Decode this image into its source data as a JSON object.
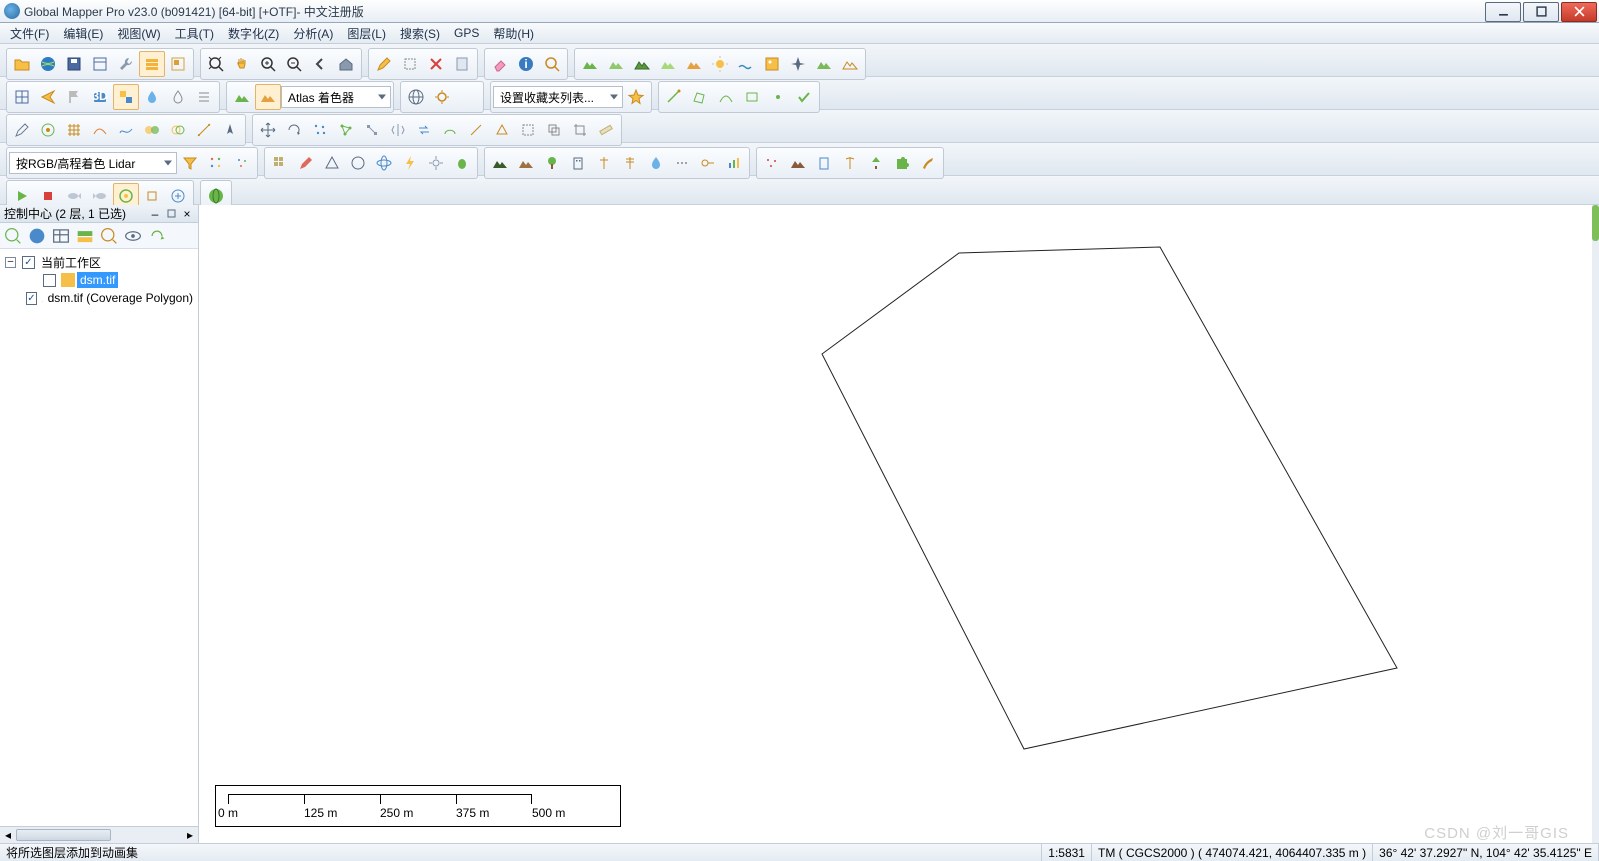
{
  "window": {
    "title": "Global Mapper Pro v23.0 (b091421) [64-bit] [+OTF]- 中文注册版"
  },
  "menu": [
    "文件(F)",
    "编辑(E)",
    "视图(W)",
    "工具(T)",
    "数字化(Z)",
    "分析(A)",
    "图层(L)",
    "搜索(S)",
    "GPS",
    "帮助(H)"
  ],
  "combos": {
    "shader": "Atlas 着色器",
    "favorites": "设置收藏夹列表...",
    "lidar": "按RGB/高程着色 Lidar"
  },
  "panel": {
    "title": "控制中心 (2 层, 1 已选)",
    "root": "当前工作区",
    "layers": [
      {
        "name": "dsm.tif",
        "checked": false,
        "selected": true
      },
      {
        "name": "dsm.tif (Coverage Polygon)",
        "checked": true,
        "selected": false
      }
    ]
  },
  "scale": {
    "labels": [
      "0 m",
      "125 m",
      "250 m",
      "375 m",
      "500 m"
    ]
  },
  "status": {
    "left": "将所选图层添加到动画集",
    "ratio": "1:5831",
    "proj": "TM ( CGCS2000 ) ( 474074.421, 4064407.335 m )",
    "coord": "36° 42' 37.2927\" N, 104° 42' 35.4125\" E"
  },
  "watermark": "CSDN @刘一哥GIS"
}
